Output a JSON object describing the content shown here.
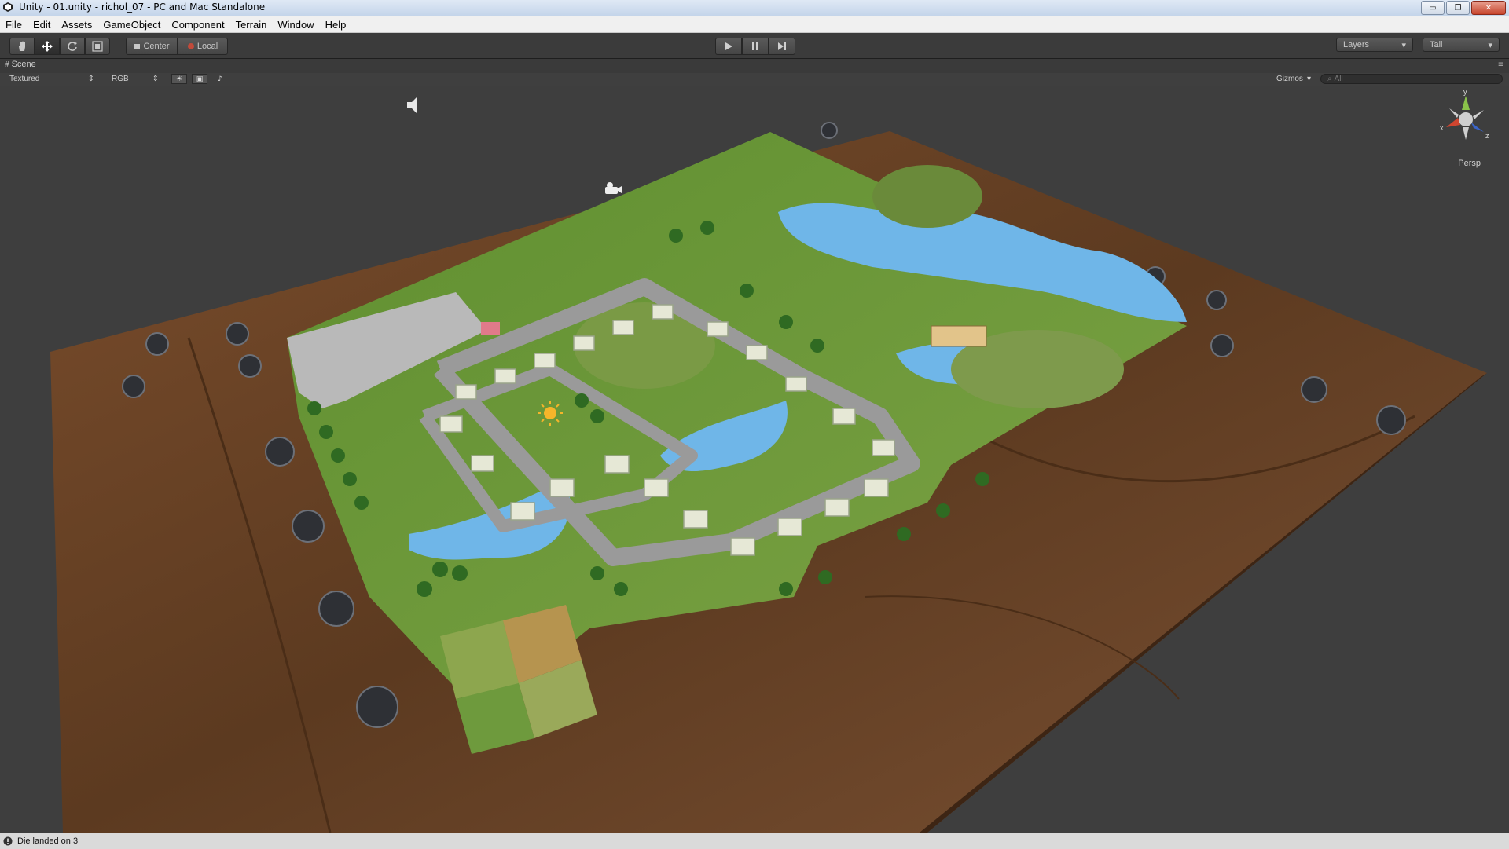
{
  "window": {
    "title": "Unity - 01.unity - richol_07 - PC and Mac Standalone",
    "minimize_label": "▭",
    "restore_label": "❐",
    "close_label": "✕"
  },
  "menu": [
    "File",
    "Edit",
    "Assets",
    "GameObject",
    "Component",
    "Terrain",
    "Window",
    "Help"
  ],
  "toolbar": {
    "tools": [
      "hand-icon",
      "move-icon",
      "rotate-icon",
      "scale-icon"
    ],
    "pivot_center": "Center",
    "pivot_local": "Local",
    "layers": "Layers",
    "layout": "Tall"
  },
  "scene": {
    "tab": "Scene",
    "render_mode": "Textured",
    "color_mode": "RGB",
    "gizmos": "Gizmos",
    "search_placeholder": "All",
    "view_mode": "Persp",
    "axis_x": "x",
    "axis_y": "y",
    "axis_z": "z"
  },
  "status": {
    "message": "Die landed on 3"
  },
  "colors": {
    "accent": "#3b3b3b",
    "water": "#6fb6e8",
    "grass": "#6f9a3c",
    "wood": "#6d4326"
  }
}
